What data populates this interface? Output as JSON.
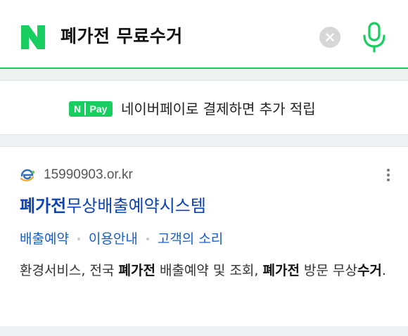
{
  "search": {
    "query": "폐가전 무료수거",
    "logo_letter": "N"
  },
  "pay_banner": {
    "badge_n": "N",
    "badge_pay": "Pay",
    "text": "네이버페이로 결제하면 추가 적립"
  },
  "result": {
    "site_url": "15990903.or.kr",
    "title_highlight": "폐가전",
    "title_rest": "무상배출예약시스템",
    "sublinks": [
      "배출예약",
      "이용안내",
      "고객의 소리"
    ],
    "desc_parts": [
      "환경서비스, 전국 ",
      "폐가전",
      " 배출예약 및 조회, ",
      "폐가전",
      " 방문 무상",
      "수거",
      "."
    ]
  },
  "colors": {
    "brand_green": "#19ce60",
    "link_blue": "#0c43b7"
  },
  "icons": [
    "naver-logo-icon",
    "clear-icon",
    "mic-icon",
    "site-favicon-icon",
    "more-vert-icon"
  ]
}
